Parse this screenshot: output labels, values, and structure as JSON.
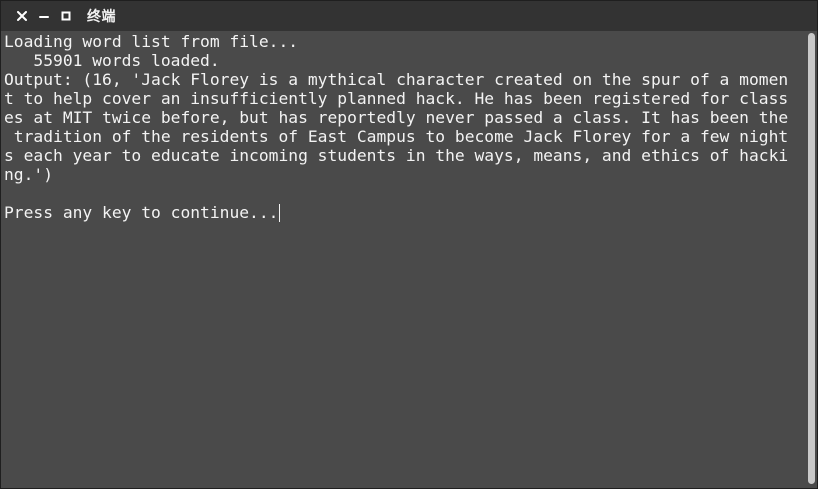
{
  "window": {
    "title": "终端"
  },
  "titlebar": {
    "buttons": [
      {
        "icon": "close-icon"
      },
      {
        "icon": "minimize-icon"
      },
      {
        "icon": "maximize-icon"
      }
    ]
  },
  "terminal": {
    "lines": [
      "Loading word list from file...",
      "   55901 words loaded.",
      "Output: (16, 'Jack Florey is a mythical character created on the spur of a momen",
      "t to help cover an insufficiently planned hack. He has been registered for class",
      "es at MIT twice before, but has reportedly never passed a class. It has been the",
      " tradition of the residents of East Campus to become Jack Florey for a few night",
      "s each year to educate incoming students in the ways, means, and ethics of hacki",
      "ng.')",
      "",
      "Press any key to continue..."
    ]
  },
  "colors": {
    "background": "#4a4a4a",
    "titlebar": "#333333",
    "text": "#f3f3f3",
    "scrollbar_thumb": "#c9c9c9"
  }
}
